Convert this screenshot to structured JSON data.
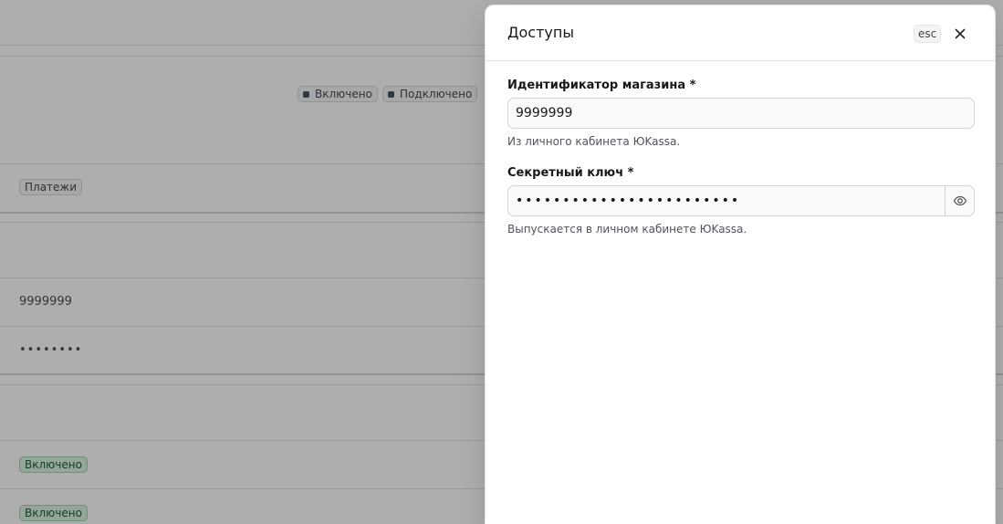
{
  "background": {
    "status_badges": [
      {
        "label": "Включено"
      },
      {
        "label": "Подключено"
      }
    ],
    "tag_badge": "Платежи",
    "shop_id_value": "9999999",
    "secret_masked": "••••••••",
    "enabled_badges": [
      "Включено",
      "Включено"
    ]
  },
  "sheet": {
    "title": "Доступы",
    "esc_label": "esc",
    "fields": [
      {
        "label": "Идентификатор магазина *",
        "value": "9999999",
        "hint": "Из личного кабинета ЮKassa."
      },
      {
        "label": "Секретный ключ *",
        "value": "••••••••••••••••••••••••",
        "hint": "Выпускается в личном кабинете ЮKassa."
      }
    ]
  },
  "icons": {
    "close": "close-icon",
    "eye": "eye-icon"
  },
  "colors": {
    "overlay": "#18181b",
    "green_badge_bg": "#d8f3df",
    "green_badge_border": "#9bd3ab"
  }
}
